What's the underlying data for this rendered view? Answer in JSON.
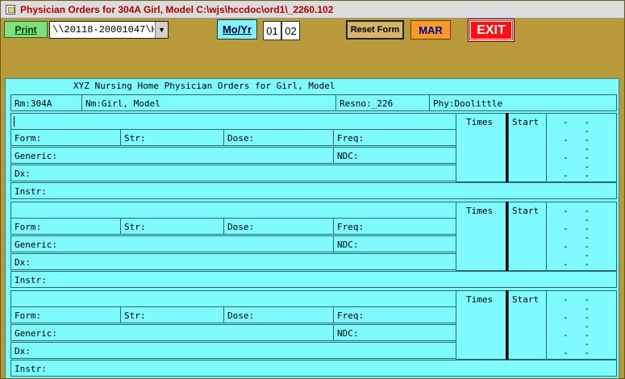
{
  "window": {
    "title": "Physician Orders for 304A Girl, Model  C:\\wjs\\hccdoc\\ord1\\_2260.102"
  },
  "toolbar": {
    "print_label": "Print",
    "path_value": "\\\\20118-20001047\\H",
    "moyr_label": "Mo/Yr",
    "month_value": "01",
    "year_value": "02",
    "reset_label": "Reset Form",
    "mar_label": "MAR",
    "exit_label": "EXIT"
  },
  "form": {
    "heading": "XYZ Nursing Home Physician Orders for Girl, Model",
    "header": {
      "rm": "Rm:304A",
      "nm": "Nm:Girl, Model",
      "resno": "Resno:_226",
      "phy": "Phy:Doolittle"
    },
    "labels": {
      "times": "Times",
      "start": "Start",
      "form": "Form:",
      "str": "Str:",
      "dose": "Dose:",
      "freq": "Freq:",
      "generic": "Generic:",
      "ndc": "NDC:",
      "dx": "Dx:",
      "instr": "Instr:"
    }
  }
}
